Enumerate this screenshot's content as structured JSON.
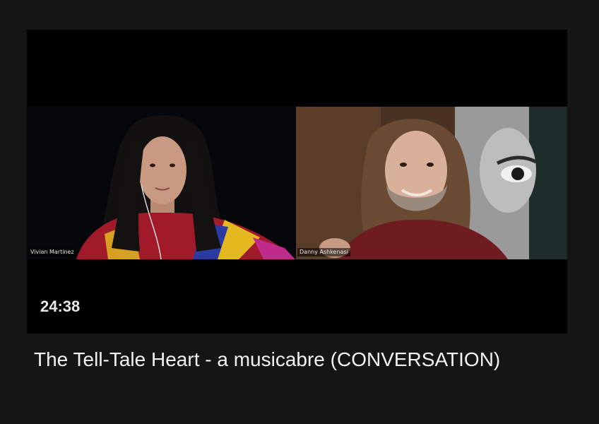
{
  "video": {
    "duration": "24:38",
    "title": "The Tell-Tale Heart - a musicabre (CONVERSATION)",
    "participants": [
      {
        "name": "Vivian Martinez"
      },
      {
        "name": "Danny Ashkenasi"
      }
    ]
  }
}
